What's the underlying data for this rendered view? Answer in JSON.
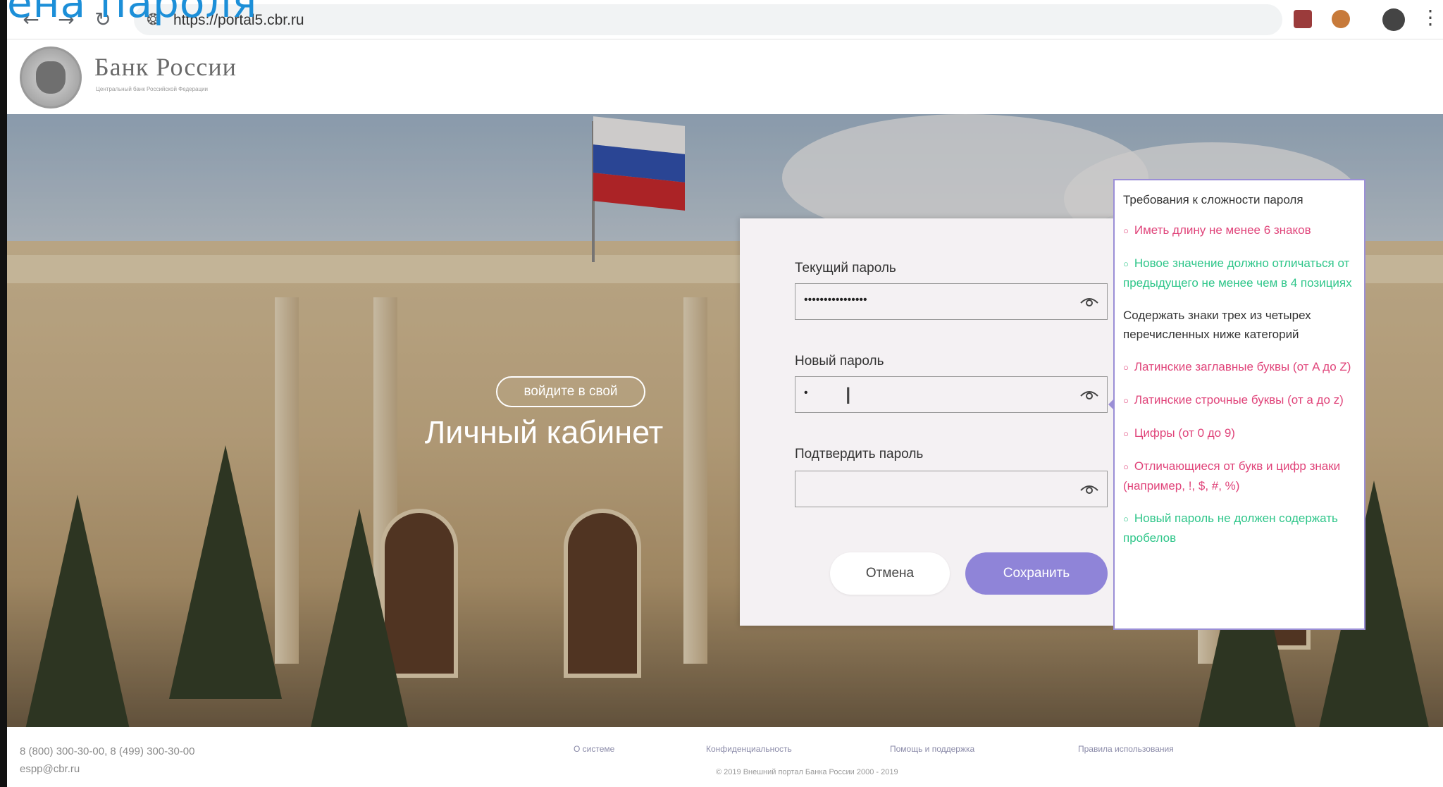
{
  "overlay": {
    "caption": "ена пароля"
  },
  "browser": {
    "url": "https://portal5.cbr.ru"
  },
  "site": {
    "logo_title": "Банк России",
    "logo_subtitle": "Центральный банк Российской Федерации"
  },
  "hero": {
    "pill_text": "войдите в свой",
    "title": "Личный кабинет"
  },
  "form": {
    "current_label": "Текущий пароль",
    "current_value": "••••••••••••••••",
    "new_label": "Новый пароль",
    "new_value": "•",
    "confirm_label": "Подтвердить пароль",
    "confirm_value": "",
    "cancel_label": "Отмена",
    "save_label": "Сохранить"
  },
  "requirements": {
    "heading": "Требования к сложности пароля",
    "subheading": "Содержать знаки трех из четырех перечисленных ниже категорий",
    "items": [
      "Иметь длину не менее 6 знаков",
      "Новое значение должно отличаться от предыдущего не менее чем в 4 позициях",
      "Латинские заглавные буквы (от A до Z)",
      "Латинские строчные буквы (от a до z)",
      "Цифры (от 0 до 9)",
      "Отличающиеся от букв и цифр знаки (например, !, $, #, %)",
      "Новый пароль не должен содержать пробелов"
    ]
  },
  "footer": {
    "phone": "8 (800) 300-30-00, 8 (499) 300-30-00",
    "email": "espp@cbr.ru",
    "links": [
      "О системе",
      "Конфиденциальность",
      "Помощь и поддержка",
      "Правила использования"
    ],
    "copyright": "© 2019 Внешний портал Банка России 2000 - 2019"
  },
  "colors": {
    "accent": "#8f84d8",
    "requirement_unmet": "#e0447a",
    "requirement_met": "#2fc68a",
    "tooltip_border": "#9b8fd6"
  }
}
